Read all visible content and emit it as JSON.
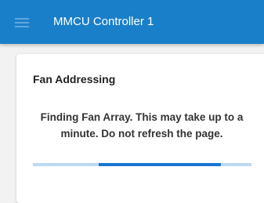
{
  "app_bar": {
    "menu_icon": "menu-icon",
    "title": "MMCU Controller 1",
    "background_color": "#1a7fc9"
  },
  "card": {
    "title": "Fan Addressing",
    "status_message": "Finding Fan Array. This may take up to a minute. Do not refresh the page.",
    "progress": {
      "type": "indeterminate",
      "bar_color": "#1976d2",
      "track_color": "#bcdaf2"
    }
  }
}
